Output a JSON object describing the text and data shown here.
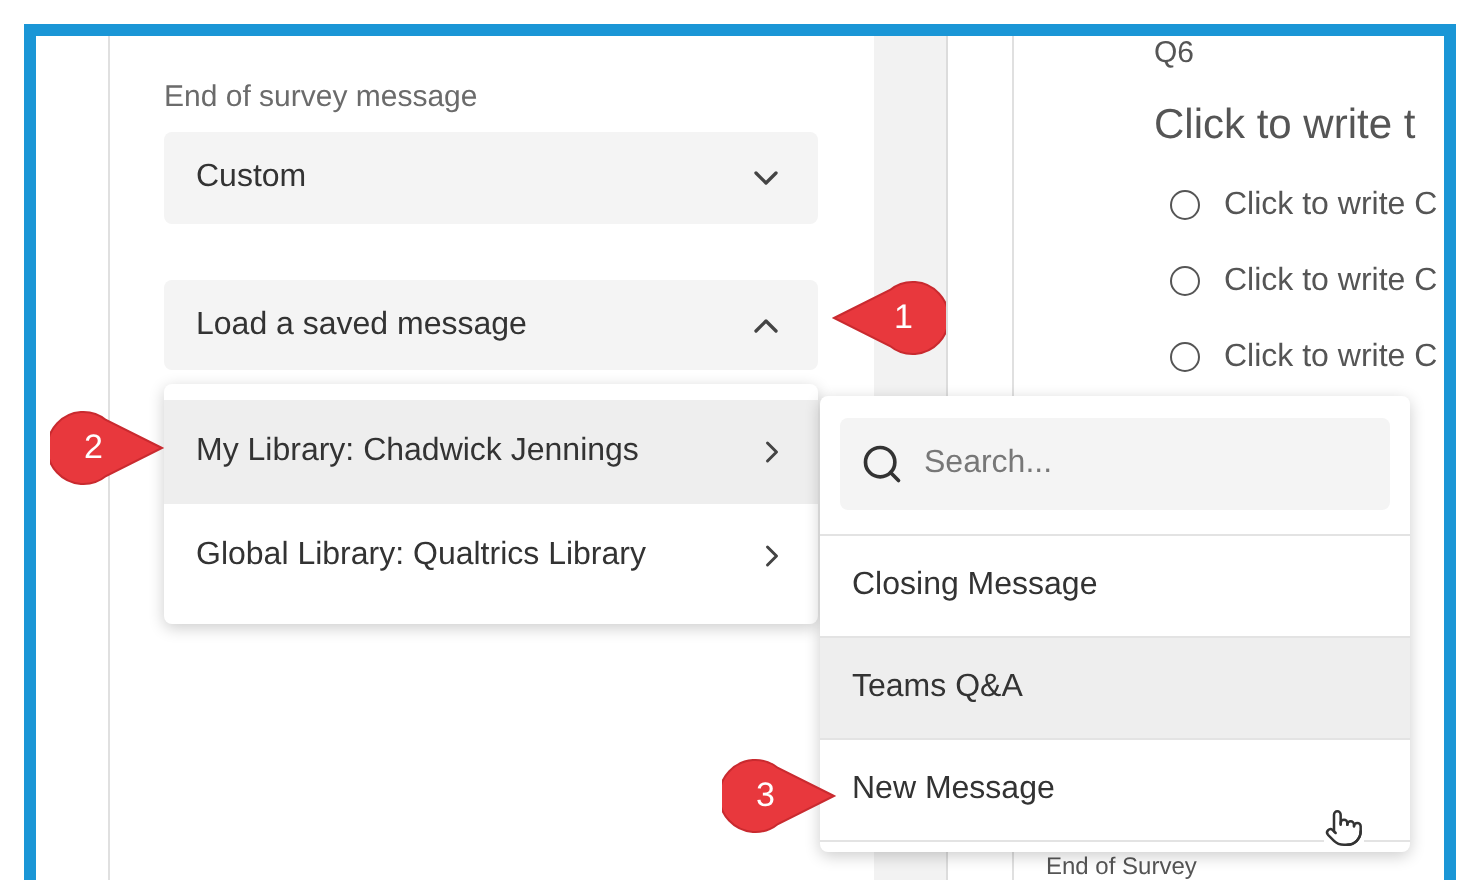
{
  "sidebar": {
    "label": "End of survey message",
    "message_select": {
      "value": "Custom",
      "expanded": false
    },
    "saved_select": {
      "value": "Load a saved message",
      "expanded": true
    }
  },
  "library_menu": {
    "items": [
      {
        "label": "My Library: Chadwick Jennings",
        "selected": true
      },
      {
        "label": "Global Library: Qualtrics Library",
        "selected": false
      }
    ]
  },
  "message_menu": {
    "search": {
      "placeholder": "Search..."
    },
    "items": [
      {
        "label": "Closing Message",
        "selected": false
      },
      {
        "label": "Teams Q&A",
        "selected": true
      },
      {
        "label": "New Message",
        "selected": false
      }
    ]
  },
  "canvas": {
    "question_number": "Q6",
    "question_text": "Click to write t",
    "choices": [
      {
        "label": "Click to write C",
        "checked": false
      },
      {
        "label": "Click to write C",
        "checked": false
      },
      {
        "label": "Click to write C",
        "checked": false
      }
    ],
    "end_label": "End of Survey"
  },
  "callouts": [
    {
      "number": "1",
      "kind": "pointing-left"
    },
    {
      "number": "2",
      "kind": "pointing-right"
    },
    {
      "number": "3",
      "kind": "pointing-right"
    }
  ]
}
